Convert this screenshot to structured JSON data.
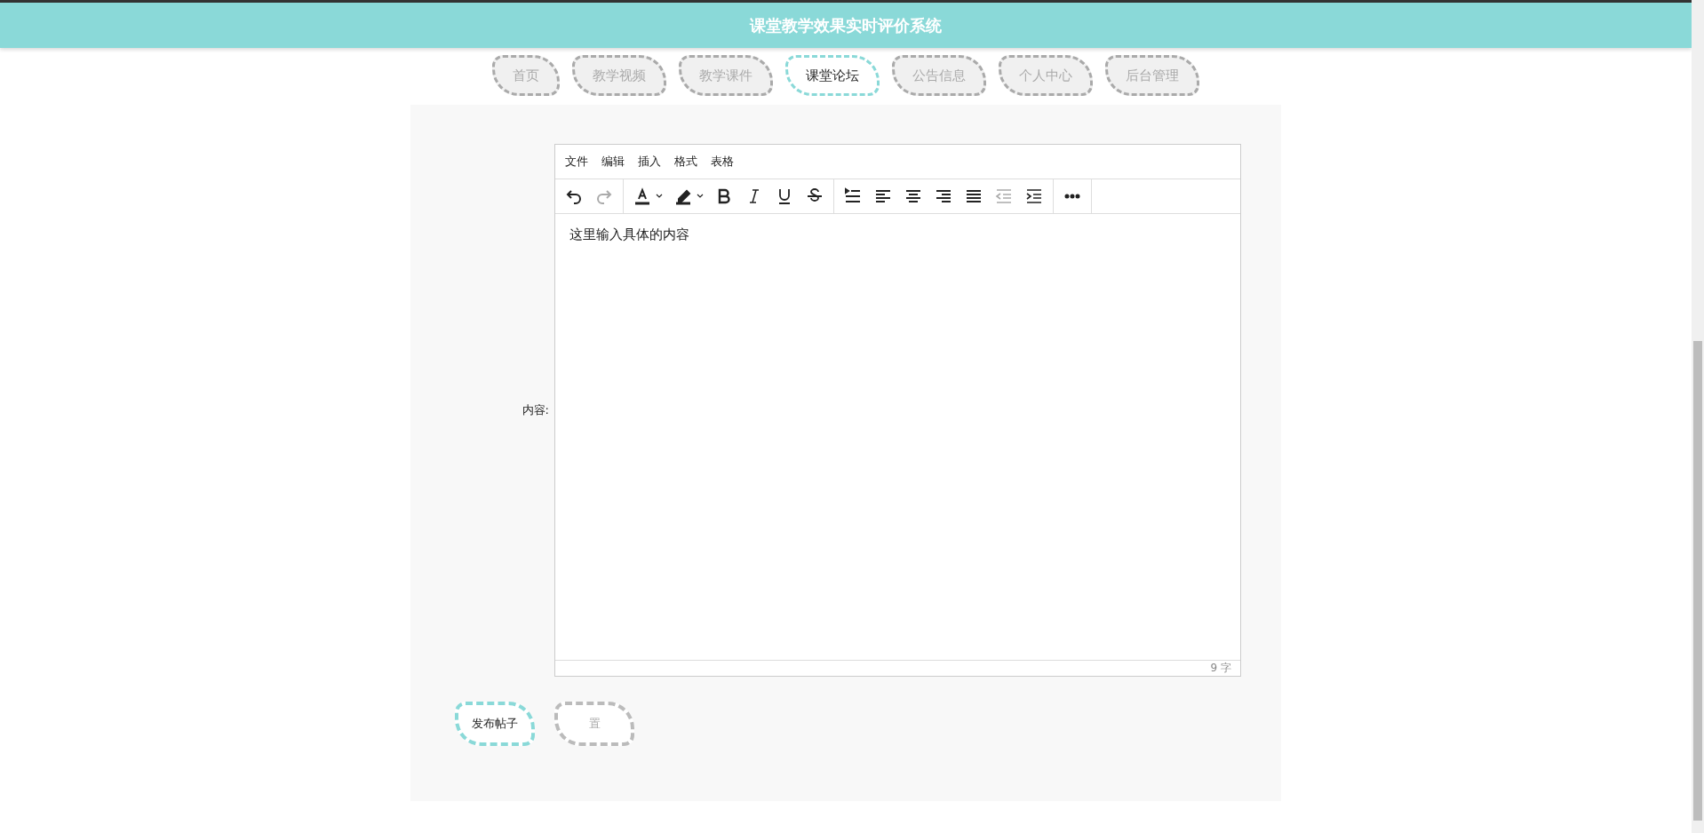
{
  "header": {
    "title": "课堂教学效果实时评价系统"
  },
  "tabs": [
    {
      "label": "首页",
      "selected": false
    },
    {
      "label": "教学视频",
      "selected": false
    },
    {
      "label": "教学课件",
      "selected": false
    },
    {
      "label": "课堂论坛",
      "selected": true
    },
    {
      "label": "公告信息",
      "selected": false
    },
    {
      "label": "个人中心",
      "selected": false
    },
    {
      "label": "后台管理",
      "selected": false
    }
  ],
  "form": {
    "content_label": "内容:",
    "editor": {
      "menu": [
        "文件",
        "编辑",
        "插入",
        "格式",
        "表格"
      ],
      "toolbar_groups": [
        {
          "buttons": [
            {
              "kind": "undo",
              "disabled": false
            },
            {
              "kind": "redo",
              "disabled": true
            }
          ]
        },
        {
          "buttons": [
            {
              "kind": "text-color",
              "disabled": false
            },
            {
              "kind": "highlight",
              "disabled": false
            },
            {
              "kind": "bold",
              "disabled": false
            },
            {
              "kind": "italic",
              "disabled": false
            },
            {
              "kind": "underline",
              "disabled": false
            },
            {
              "kind": "strike",
              "disabled": false
            }
          ]
        },
        {
          "buttons": [
            {
              "kind": "line-height",
              "disabled": false
            },
            {
              "kind": "align-left",
              "disabled": false
            },
            {
              "kind": "align-center",
              "disabled": false
            },
            {
              "kind": "align-right",
              "disabled": false
            },
            {
              "kind": "justify",
              "disabled": false
            },
            {
              "kind": "outdent",
              "disabled": true
            },
            {
              "kind": "indent",
              "disabled": false
            }
          ]
        },
        {
          "buttons": [
            {
              "kind": "more",
              "disabled": false
            }
          ]
        }
      ],
      "value": "这里输入具体的内容",
      "word_count": "9 字"
    },
    "buttons": [
      {
        "label": "发布帖子",
        "kind": "primary"
      },
      {
        "label": "置",
        "kind": "secondary"
      }
    ]
  }
}
